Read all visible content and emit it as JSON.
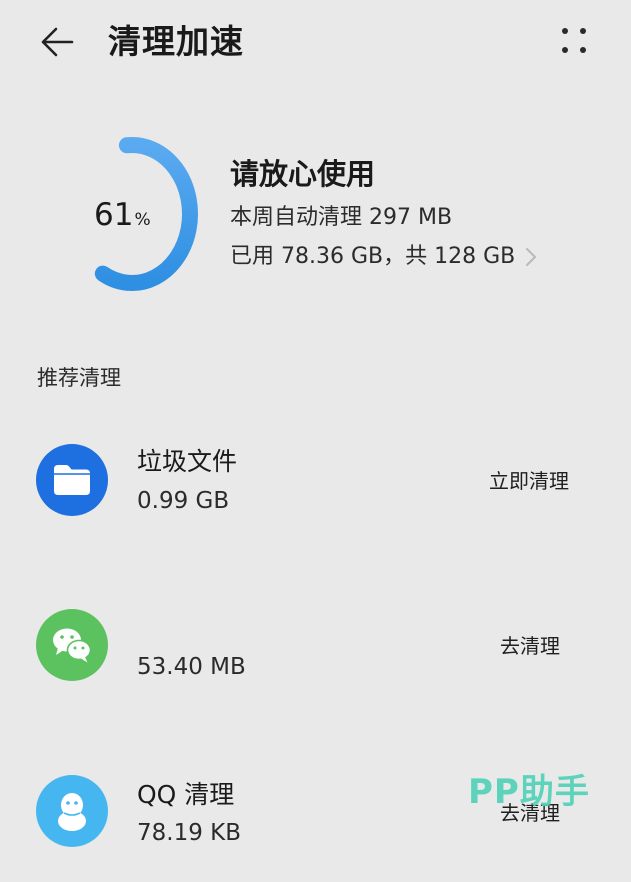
{
  "header": {
    "title": "清理加速",
    "back_icon": "arrow-left-icon",
    "more_icon": "more-dots-icon"
  },
  "storage": {
    "percent": "61",
    "percent_unit": "%",
    "used_fraction": 0.61,
    "status_title": "请放心使用",
    "weekly_auto_clean": "本周自动清理 297 MB",
    "usage_summary": "已用 78.36 GB，共 128 GB",
    "ring_color": "#3d9ae6"
  },
  "section": {
    "title": "推荐清理"
  },
  "items": [
    {
      "title": "垃圾文件",
      "size": "0.99 GB",
      "action": "立即清理",
      "icon": "folder-icon",
      "icon_color": "#1e6fe0"
    },
    {
      "title": "",
      "size": "53.40 MB",
      "action": "去清理",
      "icon": "wechat-icon",
      "icon_color": "#5cc25f"
    },
    {
      "title": "QQ 清理",
      "size": "78.19 KB",
      "action": "去清理",
      "icon": "qq-icon",
      "icon_color": "#46b6f0"
    }
  ],
  "watermark": "PP助手"
}
